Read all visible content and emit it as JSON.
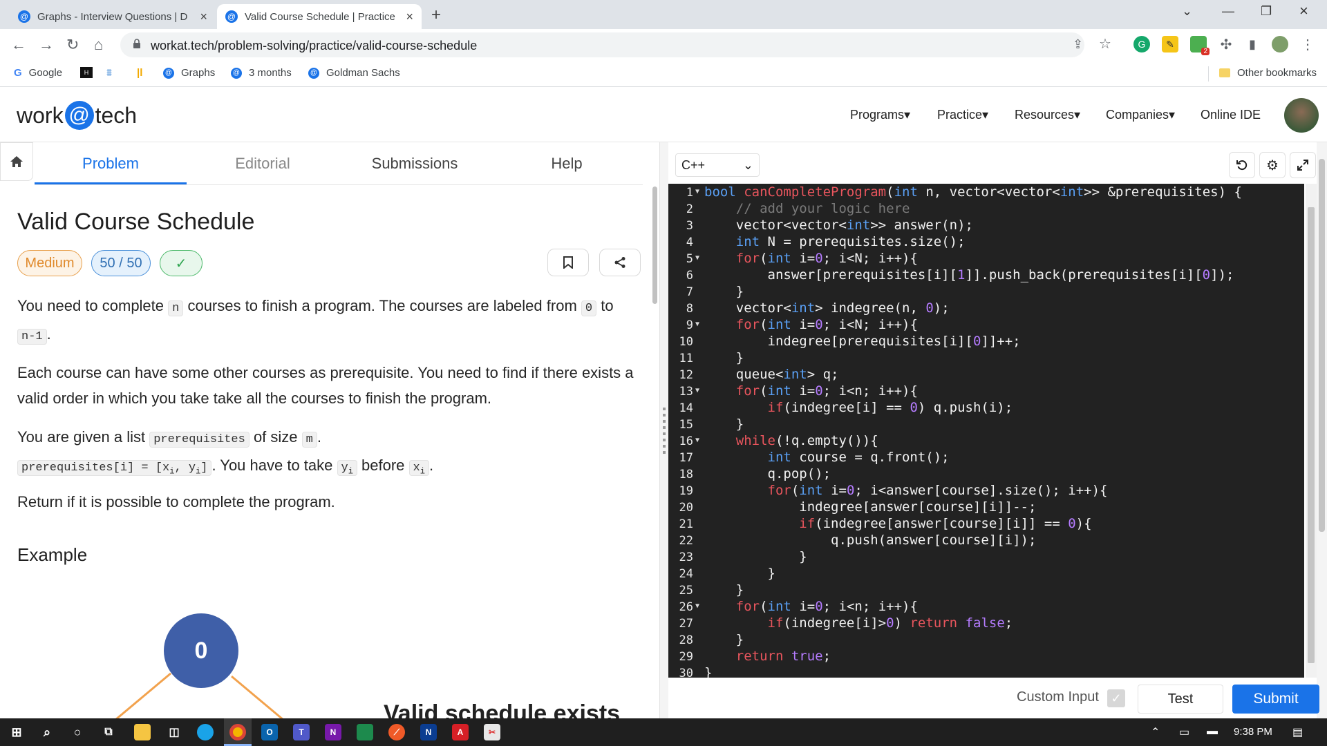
{
  "browser": {
    "tabs": [
      {
        "title": "Graphs - Interview Questions | D",
        "active": false
      },
      {
        "title": "Valid Course Schedule | Practice",
        "active": true
      }
    ],
    "url": "workat.tech/problem-solving/practice/valid-course-schedule",
    "bookmarks": [
      "Google",
      "Graphs",
      "3 months",
      "Goldman Sachs"
    ],
    "other_bookmarks": "Other bookmarks",
    "new_tab": "+",
    "ext_badge": "2"
  },
  "site": {
    "logo_left": "work",
    "logo_at": "@",
    "logo_right": "tech",
    "nav": [
      "Programs",
      "Practice",
      "Resources",
      "Companies",
      "Online IDE"
    ],
    "caret": "▾"
  },
  "problem": {
    "tabs": [
      "Problem",
      "Editorial",
      "Submissions",
      "Help"
    ],
    "title": "Valid Course Schedule",
    "difficulty": "Medium",
    "score": "50 / 50",
    "check": "✓",
    "p1": {
      "a": "You need to complete ",
      "b": "n",
      "c": " courses to finish a program. The courses are labeled from ",
      "d": "0",
      "e": " to ",
      "f": "n-1",
      "g": "."
    },
    "p2": "Each course can have some other courses as prerequisite. You need to find if there exists a valid order in which you take take all the courses to finish the program.",
    "p3": {
      "a": "You are given a list ",
      "b": "prerequisites",
      "c": " of size ",
      "d": "m",
      "e": ".",
      "f": "prerequisites[i] = [x",
      "g": "i",
      "h": ", y",
      "i": "i",
      "j": "]",
      "k": ". You have to take ",
      "l": "y",
      "m": "i",
      "n": " before ",
      "o": "x",
      "p": "i",
      "q": "."
    },
    "p4": "Return if it is possible to complete the program.",
    "example_heading": "Example",
    "node_label": "0",
    "caption": "Valid schedule exists"
  },
  "editor": {
    "language": "C++",
    "language_caret": "⌄",
    "code": [
      "bool canCompleteProgram(int n, vector<vector<int>> &prerequisites) {",
      "    // add your logic here",
      "    vector<vector<int>> answer(n);",
      "    int N = prerequisites.size();",
      "    for(int i=0; i<N; i++){",
      "        answer[prerequisites[i][1]].push_back(prerequisites[i][0]);",
      "    }",
      "    vector<int> indegree(n, 0);",
      "    for(int i=0; i<N; i++){",
      "        indegree[prerequisites[i][0]]++;",
      "    }",
      "    queue<int> q;",
      "    for(int i=0; i<n; i++){",
      "        if(indegree[i] == 0) q.push(i);",
      "    }",
      "    while(!q.empty()){",
      "        int course = q.front();",
      "        q.pop();",
      "        for(int i=0; i<answer[course].size(); i++){",
      "            indegree[answer[course][i]]--;",
      "            if(indegree[answer[course][i]] == 0){",
      "                q.push(answer[course][i]);",
      "            }",
      "        }",
      "    }",
      "    for(int i=0; i<n; i++){",
      "        if(indegree[i]>0) return false;",
      "    }",
      "    return true;",
      "}"
    ],
    "foldable_lines": [
      1,
      5,
      9,
      13,
      16,
      26
    ],
    "custom_input_label": "Custom Input",
    "test_label": "Test",
    "submit_label": "Submit"
  },
  "taskbar": {
    "time": "9:38 PM"
  },
  "colors": {
    "accent": "#1a73e8",
    "editor_bg": "#222222",
    "keyword": "#e8555d",
    "type": "#5aa0f5",
    "number": "#b57cff",
    "comment": "#7a7a7a"
  }
}
